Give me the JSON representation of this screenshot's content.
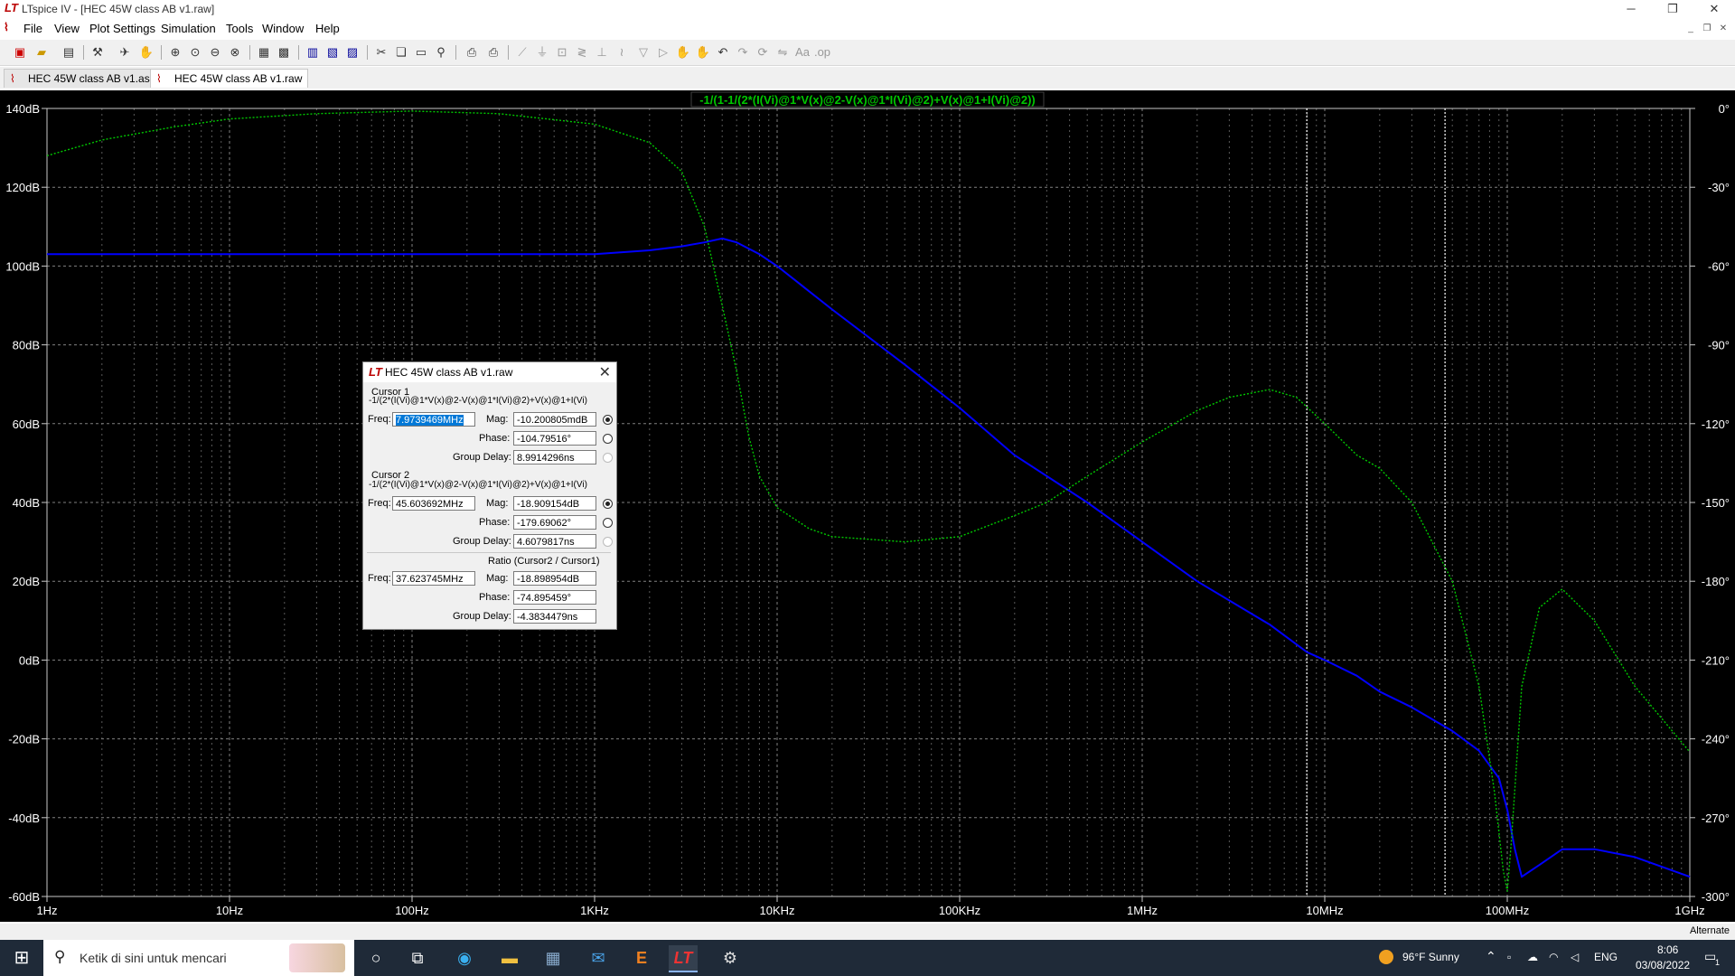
{
  "window": {
    "title": "LTspice IV - [HEC 45W class AB v1.raw]",
    "minimize": "─",
    "restore": "❐",
    "close": "✕"
  },
  "menu": [
    "File",
    "View",
    "Plot Settings",
    "Simulation",
    "Tools",
    "Window",
    "Help"
  ],
  "tabs": [
    {
      "label": "HEC 45W class AB v1.asc",
      "active": false
    },
    {
      "label": "HEC 45W class AB v1.raw",
      "active": true
    }
  ],
  "plot": {
    "trace_label": "-1/(1-1/(2*(I(Vi)@1*V(x)@2-V(x)@1*I(Vi)@2)+V(x)@1+I(Vi)@2))",
    "colors": {
      "background": "#000000",
      "magnitude": "#0000ff",
      "phase": "#00c800",
      "grid": "#808080",
      "text": "#ffffff"
    }
  },
  "chart_data": {
    "type": "line",
    "x_scale": "log",
    "xlim": [
      1,
      1000000000
    ],
    "x_ticks": [
      "1Hz",
      "10Hz",
      "100Hz",
      "1KHz",
      "10KHz",
      "100KHz",
      "1MHz",
      "10MHz",
      "100MHz",
      "1GHz"
    ],
    "ylim_left": [
      -60,
      140
    ],
    "y_ticks_left": [
      "140dB",
      "120dB",
      "100dB",
      "80dB",
      "60dB",
      "40dB",
      "20dB",
      "0dB",
      "-20dB",
      "-40dB",
      "-60dB"
    ],
    "ylim_right": [
      -300,
      0
    ],
    "y_ticks_right": [
      "0°",
      "-30°",
      "-60°",
      "-90°",
      "-120°",
      "-150°",
      "-180°",
      "-210°",
      "-240°",
      "-270°",
      "-300°"
    ],
    "grid": true,
    "cursors_hz": [
      7973946.9,
      45603692
    ],
    "series": [
      {
        "axis": "left",
        "style": "solid",
        "x": [
          1,
          10,
          100,
          1000,
          2000,
          3000,
          4000,
          5000,
          6000,
          8000,
          10000,
          20000,
          50000,
          100000,
          200000,
          500000,
          1000000,
          2000000,
          5000000,
          8000000,
          10000000,
          15000000,
          20000000,
          30000000,
          50000000,
          70000000,
          90000000,
          100000000,
          110000000,
          120000000,
          150000000,
          200000000,
          300000000,
          500000000,
          1000000000
        ],
        "y": [
          103,
          103,
          103,
          103,
          104,
          105,
          106,
          107,
          106,
          103,
          100,
          89,
          75,
          64,
          52,
          40,
          30,
          20,
          9,
          2,
          0,
          -4,
          -8,
          -12,
          -18,
          -23,
          -30,
          -38,
          -48,
          -55,
          -52,
          -48,
          -48,
          -50,
          -55
        ]
      },
      {
        "axis": "right",
        "style": "dotted",
        "x": [
          1,
          2,
          5,
          10,
          30,
          100,
          300,
          1000,
          2000,
          3000,
          4000,
          5000,
          6000,
          7000,
          8000,
          10000,
          15000,
          20000,
          50000,
          100000,
          200000,
          300000,
          500000,
          1000000,
          2000000,
          3000000,
          5000000,
          7000000,
          10000000,
          15000000,
          20000000,
          30000000,
          50000000,
          70000000,
          85000000,
          95000000,
          100000000,
          105000000,
          120000000,
          150000000,
          200000000,
          300000000,
          500000000,
          1000000000
        ],
        "y": [
          -18,
          -12,
          -7,
          -4,
          -2,
          -1,
          -2,
          -6,
          -13,
          -24,
          -45,
          -75,
          -100,
          -125,
          -140,
          -152,
          -160,
          -163,
          -165,
          -163,
          -155,
          -150,
          -140,
          -127,
          -115,
          -110,
          -107,
          -110,
          -120,
          -132,
          -137,
          -150,
          -180,
          -220,
          -260,
          -290,
          -298,
          -280,
          -220,
          -190,
          -183,
          -195,
          -220,
          -245
        ]
      }
    ]
  },
  "dialog": {
    "title": "HEC 45W class AB v1.raw",
    "cursor1": {
      "heading": "Cursor 1",
      "expr": "-1/(2*(I(Vi)@1*V(x)@2-V(x)@1*I(Vi)@2)+V(x)@1+I(Vi)",
      "freq_label": "Freq:",
      "freq": "7.9739469MHz",
      "mag_label": "Mag:",
      "mag": "-10.200805mdB",
      "phase_label": "Phase:",
      "phase": "-104.79516°",
      "gd_label": "Group Delay:",
      "gd": "8.9914296ns"
    },
    "cursor2": {
      "heading": "Cursor 2",
      "expr": "-1/(2*(I(Vi)@1*V(x)@2-V(x)@1*I(Vi)@2)+V(x)@1+I(Vi)",
      "freq_label": "Freq:",
      "freq": "45.603692MHz",
      "mag_label": "Mag:",
      "mag": "-18.909154dB",
      "phase_label": "Phase:",
      "phase": "-179.69062°",
      "gd_label": "Group Delay:",
      "gd": "4.6079817ns"
    },
    "ratio": {
      "heading": "Ratio (Cursor2 / Cursor1)",
      "freq_label": "Freq:",
      "freq": "37.623745MHz",
      "mag_label": "Mag:",
      "mag": "-18.898954dB",
      "phase_label": "Phase:",
      "phase": "-74.895459°",
      "gd_label": "Group Delay:",
      "gd": "-4.3834479ns"
    }
  },
  "statusbar": {
    "text": "Alternate"
  },
  "taskbar": {
    "search_placeholder": "Ketik di sini untuk mencari",
    "weather": "96°F  Sunny",
    "lang": "ENG",
    "time": "8:06",
    "date": "03/08/2022",
    "notifications": "1"
  }
}
